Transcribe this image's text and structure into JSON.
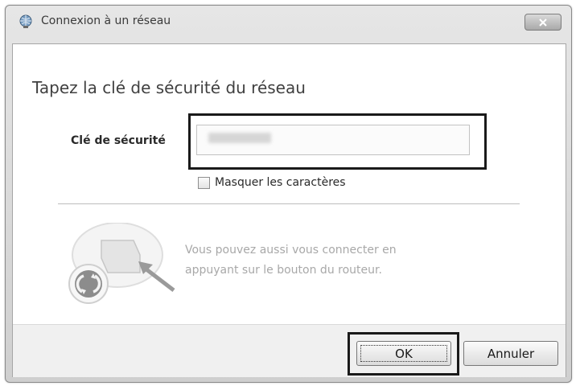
{
  "window": {
    "title": "Connexion à un réseau",
    "close_icon": "close-icon",
    "title_icon": "network-icon"
  },
  "dialog": {
    "heading": "Tapez la clé de sécurité du réseau",
    "key_label": "Clé de sécurité",
    "key_value": "",
    "mask_label": "Masquer les caractères",
    "mask_checked": false,
    "router_line1": "Vous pouvez aussi vous connecter en",
    "router_line2": "appuyant sur le bouton du routeur.",
    "router_icon": "router-wps-icon"
  },
  "buttons": {
    "ok": "OK",
    "cancel": "Annuler"
  },
  "colors": {
    "highlight": "#1a1a1a",
    "hint_text": "#a8a8a8"
  }
}
